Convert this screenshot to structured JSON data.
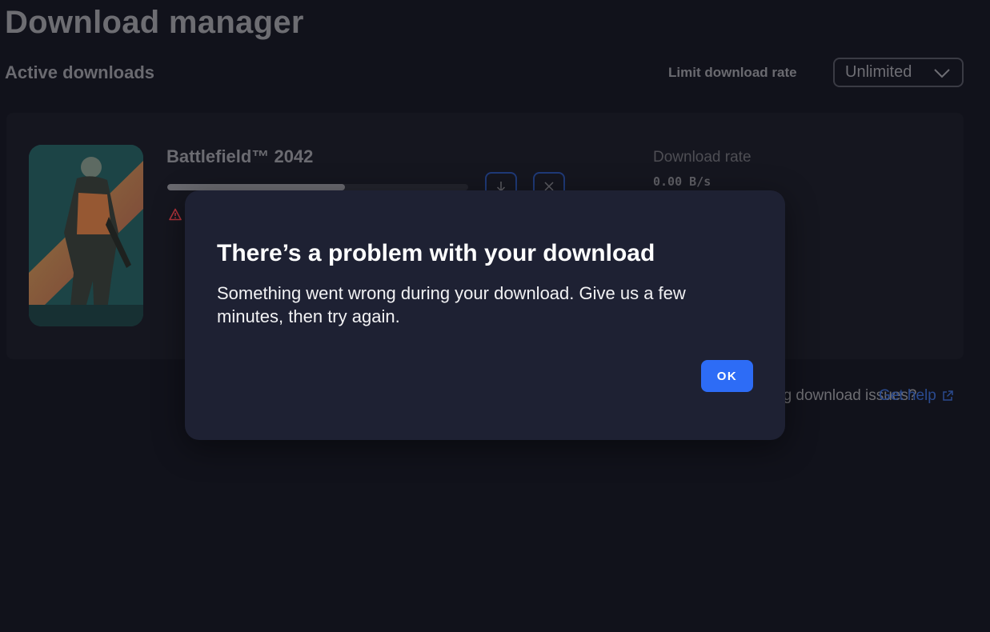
{
  "header": {
    "page_title": "Download manager",
    "section_title": "Active downloads",
    "limit_label": "Limit download rate",
    "rate_select_value": "Unlimited"
  },
  "download": {
    "game_title": "Battlefield™ 2042",
    "progress_fraction": 0.59,
    "rate_label": "Download rate",
    "rate_value": "0.00 B/s"
  },
  "help": {
    "text": "Having download issues?",
    "link_label": "Get help"
  },
  "dialog": {
    "title": "There’s a problem with your download",
    "body": "Something went wrong during your download. Give us a few minutes, then try again.",
    "ok_label": "OK"
  },
  "colors": {
    "background": "#11121b",
    "card": "#15161f",
    "dialog": "#1e2133",
    "accent": "#2d6cf6",
    "warning": "#b3333b",
    "link": "#2a4a8f"
  },
  "icons": {
    "dropdown": "chevron-down-icon",
    "warning": "warning-icon",
    "resume": "download-arrow-icon",
    "cancel": "close-icon",
    "external": "external-link-icon"
  }
}
